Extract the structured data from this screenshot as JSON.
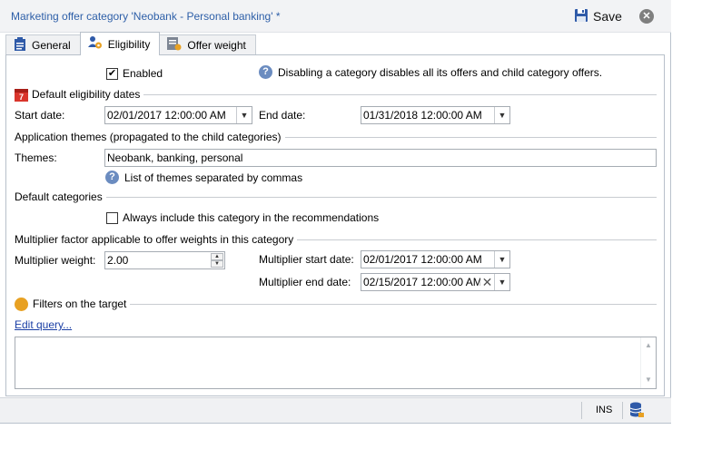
{
  "window": {
    "title": "Marketing offer category 'Neobank - Personal banking' *",
    "save_label": "Save",
    "close_glyph": "✕"
  },
  "tabs": [
    {
      "label": "General",
      "icon": "clipboard-icon",
      "active": false
    },
    {
      "label": "Eligibility",
      "icon": "users-gear-icon",
      "active": true
    },
    {
      "label": "Offer weight",
      "icon": "weight-form-icon",
      "active": false
    }
  ],
  "eligibility": {
    "enabled_label": "Enabled",
    "enabled_checked": true,
    "enabled_help": "Disabling a category disables all its offers and child category offers.",
    "dates_section": "Default eligibility dates",
    "start_date_label": "Start date:",
    "start_date_value": "02/01/2017 12:00:00 AM",
    "end_date_label": "End date:",
    "end_date_value": "01/31/2018 12:00:00 AM",
    "themes_section": "Application themes (propagated to the child categories)",
    "themes_label": "Themes:",
    "themes_value": "Neobank, banking, personal",
    "themes_help": "List of themes separated by commas",
    "default_categories_section": "Default categories",
    "always_include_label": "Always include this category in the recommendations",
    "always_include_checked": false,
    "multiplier_section": "Multiplier factor applicable to offer weights in this category",
    "multiplier_weight_label": "Multiplier weight:",
    "multiplier_weight_value": "2.00",
    "multiplier_start_label": "Multiplier start date:",
    "multiplier_start_value": "02/01/2017 12:00:00 AM",
    "multiplier_end_label": "Multiplier end date:",
    "multiplier_end_value": "02/15/2017 12:00:00 AM",
    "filters_section": "Filters on the target",
    "edit_query_link": "Edit query...",
    "query_text": ""
  },
  "statusbar": {
    "ins_label": "INS",
    "db_icon": "database-icon"
  },
  "colors": {
    "title_text": "#2e5fa8",
    "filter_dot": "#e8a123",
    "help_icon": "#6b8cc0",
    "calendar_red": "#d9352c"
  },
  "icons": {
    "save": "floppy-disk-icon",
    "help": "question-circle-icon",
    "calendar": "calendar-icon",
    "dropdown": "chevron-down-icon",
    "clear": "clear-x-icon"
  }
}
